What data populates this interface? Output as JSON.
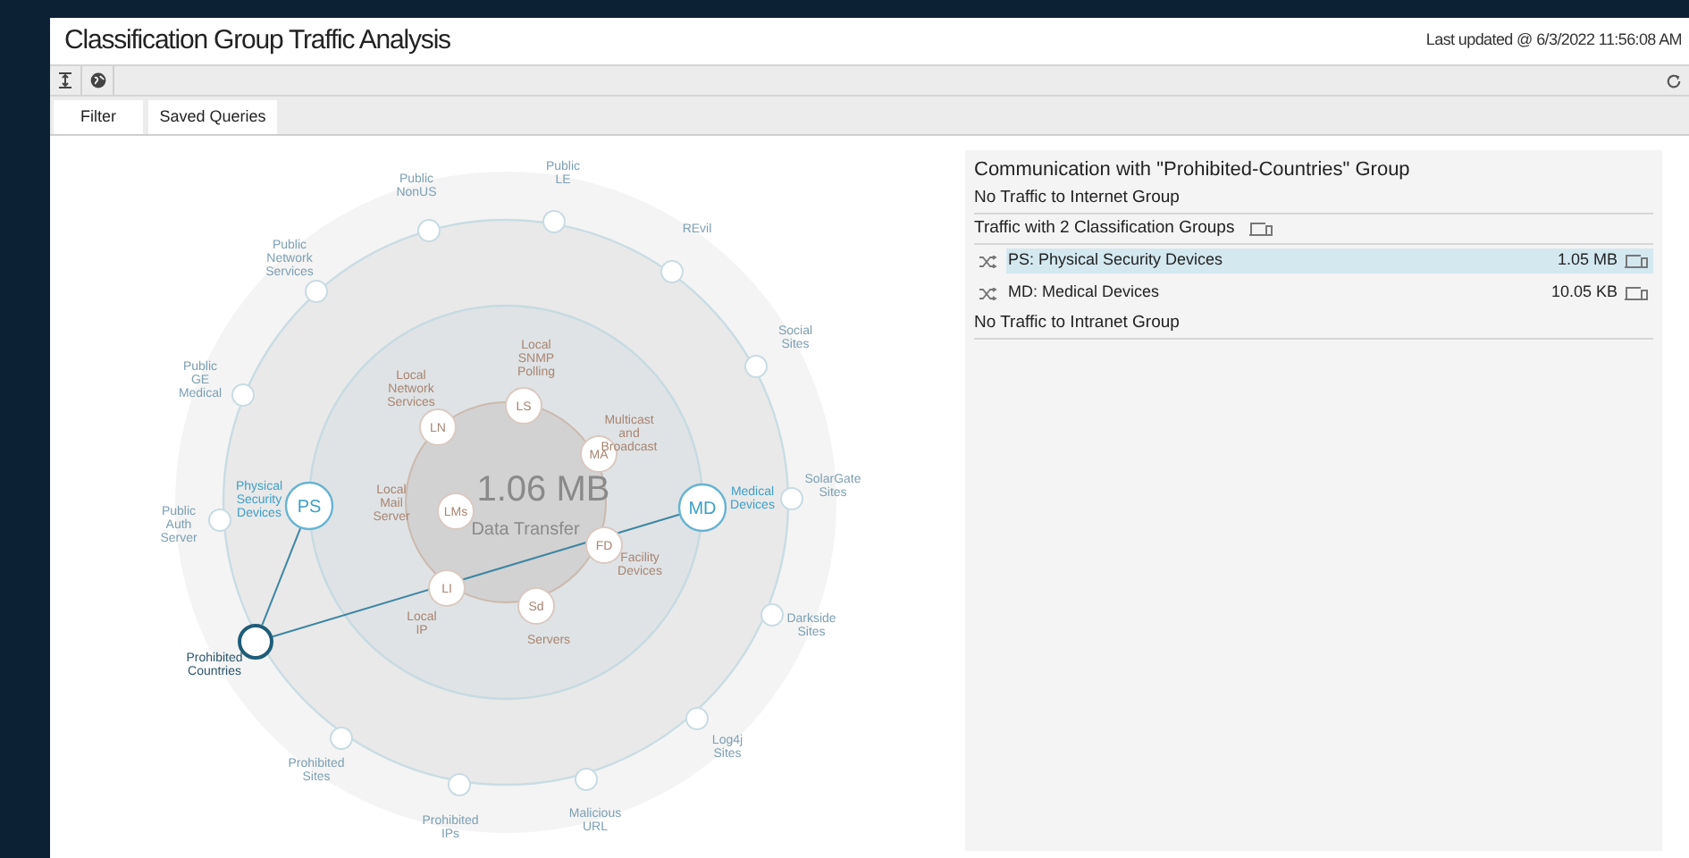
{
  "header": {
    "title": "Classification Group Traffic Analysis",
    "last_updated": "Last updated @ 6/3/2022 11:56:08 AM"
  },
  "tabs": [
    {
      "label": "Filter"
    },
    {
      "label": "Saved Queries"
    }
  ],
  "diagram": {
    "total": "1.06 MB",
    "total_caption": "Data Transfer",
    "nodes": [
      {
        "kind": "external",
        "label": "Public NonUS",
        "selected": false
      },
      {
        "kind": "external",
        "label": "Public LE",
        "selected": false
      },
      {
        "kind": "external",
        "label": "REvil",
        "selected": false
      },
      {
        "kind": "external",
        "label": "Social Sites",
        "selected": false
      },
      {
        "kind": "external",
        "label": "SolarGate Sites",
        "selected": false
      },
      {
        "kind": "external",
        "label": "Darkside Sites",
        "selected": false
      },
      {
        "kind": "external",
        "label": "Log4j Sites",
        "selected": false
      },
      {
        "kind": "external",
        "label": "Malicious URL",
        "selected": false
      },
      {
        "kind": "external",
        "label": "Prohibited IPs",
        "selected": false
      },
      {
        "kind": "external",
        "label": "Prohibited Sites",
        "selected": false
      },
      {
        "kind": "external",
        "label": "Prohibited Countries",
        "selected": true
      },
      {
        "kind": "external",
        "label": "Public Auth Server",
        "selected": false
      },
      {
        "kind": "external",
        "label": "Public GE Medical",
        "selected": false
      },
      {
        "kind": "external",
        "label": "Public Network Services",
        "selected": false
      },
      {
        "kind": "classification",
        "abbr": "PS",
        "label": "Physical Security Devices",
        "linked": true
      },
      {
        "kind": "classification",
        "abbr": "MD",
        "label": "Medical Devices",
        "linked": true
      },
      {
        "kind": "local",
        "abbr": "LN",
        "label": "Local Network Services"
      },
      {
        "kind": "local",
        "abbr": "LS",
        "label": "Local SNMP Polling"
      },
      {
        "kind": "local",
        "abbr": "MA",
        "label": "Multicast and Broadcast"
      },
      {
        "kind": "local",
        "abbr": "LMs",
        "label": "Local Mail Server"
      },
      {
        "kind": "local",
        "abbr": "FD",
        "label": "Facility Devices"
      },
      {
        "kind": "local",
        "abbr": "LI",
        "label": "Local IP"
      },
      {
        "kind": "local",
        "abbr": "Sd",
        "label": "Servers"
      }
    ]
  },
  "detail": {
    "title": "Communication with \"Prohibited-Countries\" Group",
    "sections": [
      {
        "kind": "note",
        "text": "No Traffic to Internet Group"
      },
      {
        "kind": "group",
        "text": "Traffic with 2 Classification Groups",
        "items": [
          {
            "label": "PS: Physical Security Devices",
            "value": "1.05 MB",
            "selected": true
          },
          {
            "label": "MD: Medical Devices",
            "value": "10.05 KB",
            "selected": false
          }
        ]
      },
      {
        "kind": "note",
        "text": "No Traffic to Intranet Group"
      }
    ]
  }
}
